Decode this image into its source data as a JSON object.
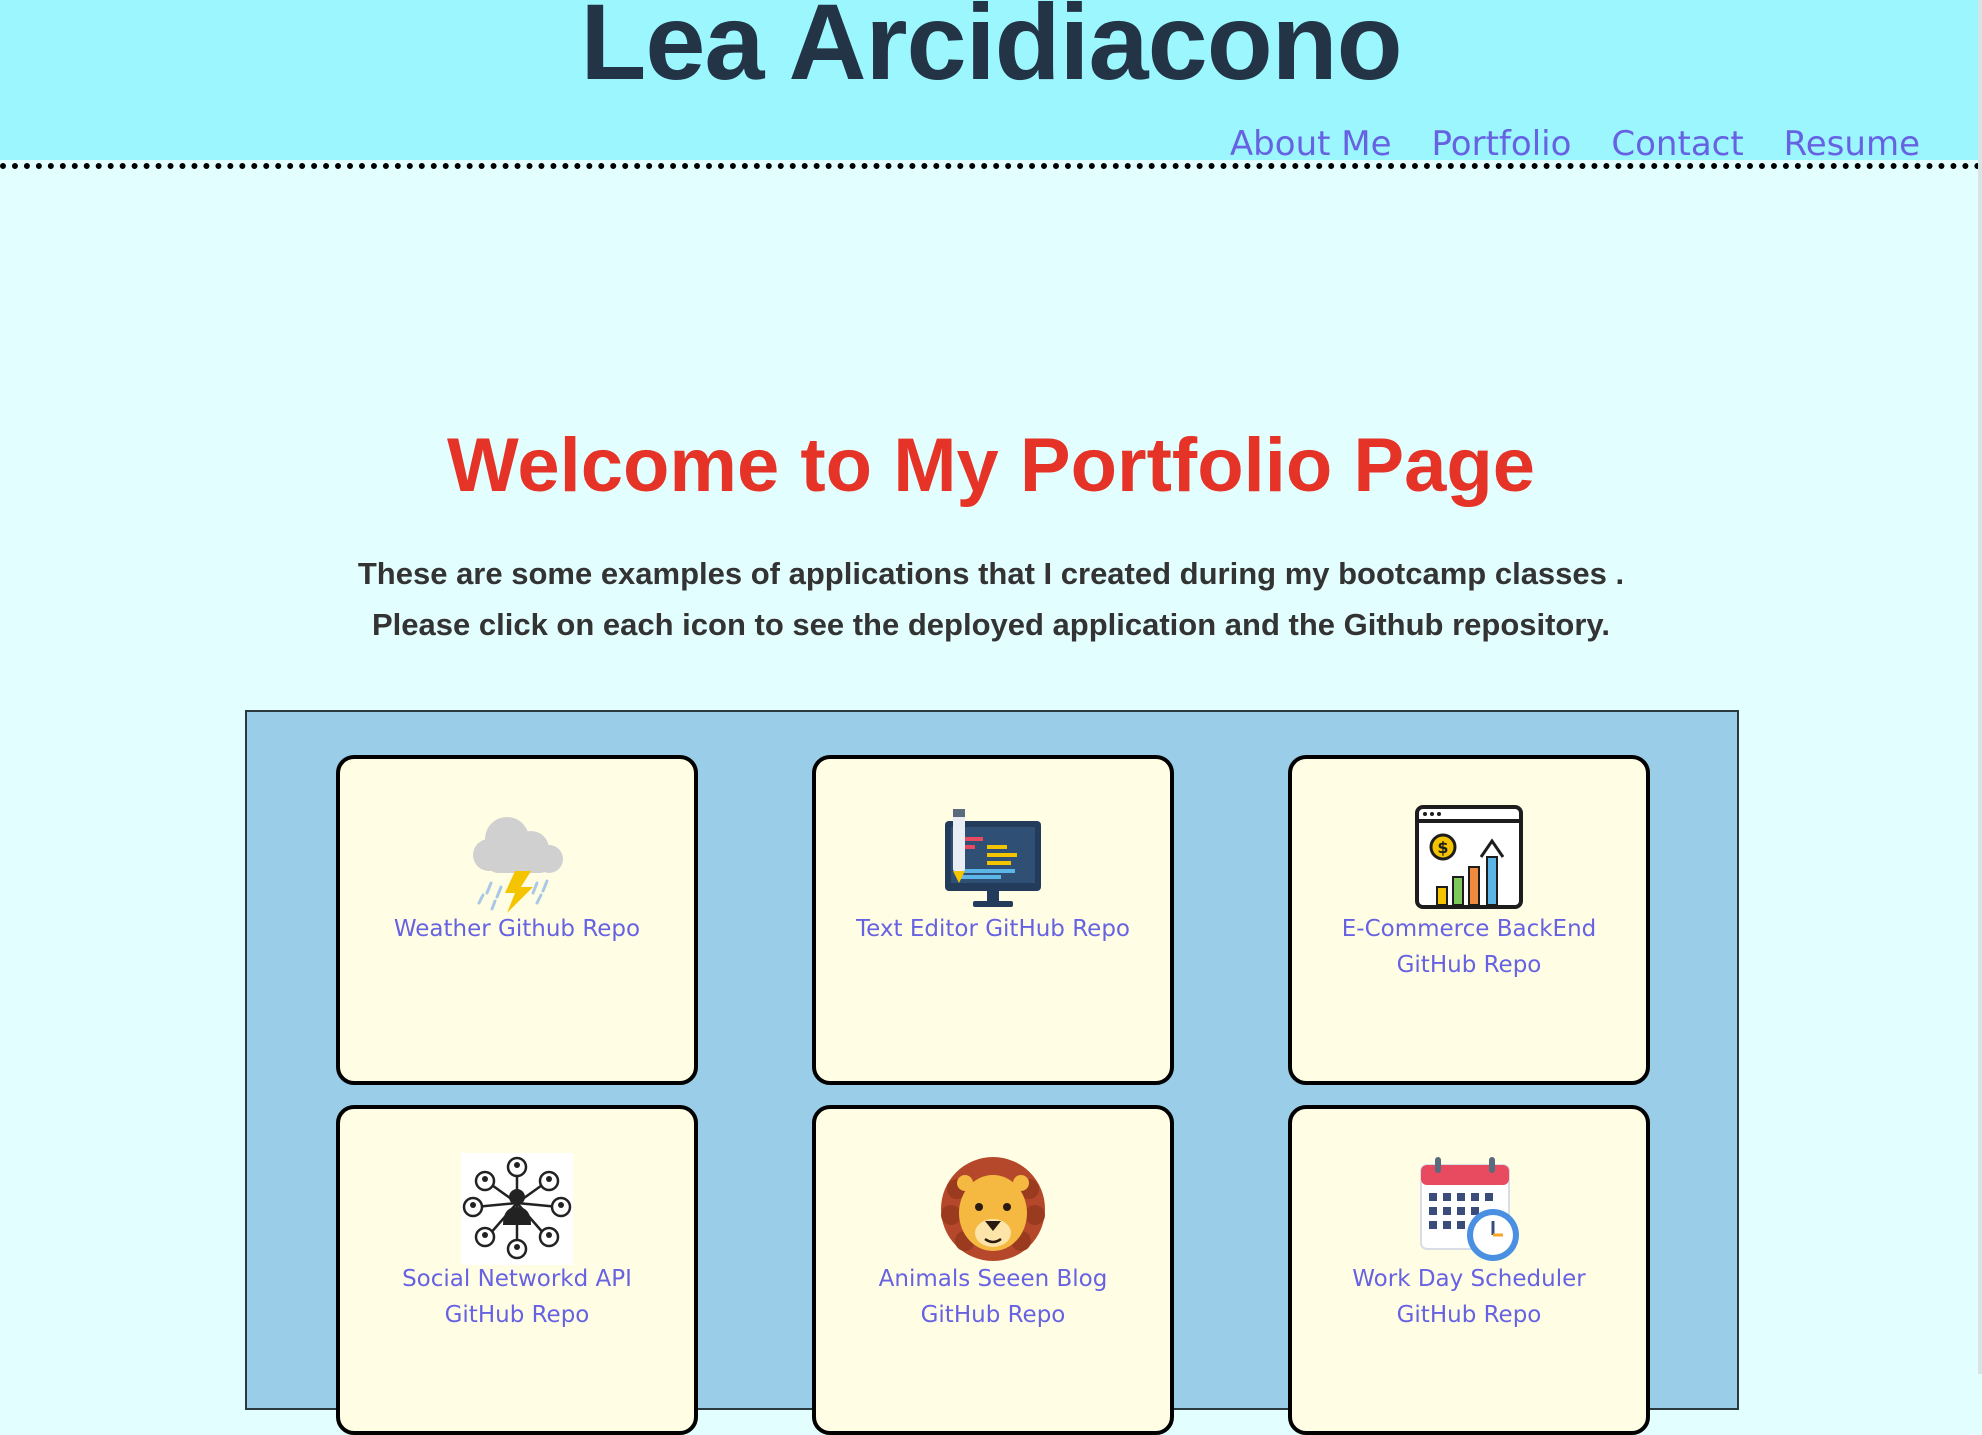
{
  "header": {
    "title": "Lea Arcidiacono",
    "nav": [
      "About Me",
      "Portfolio",
      "Contact",
      "Resume"
    ]
  },
  "main": {
    "heading": "Welcome to My Portfolio Page",
    "intro_line1": "These are some examples of applications that I created during my bootcamp classes .",
    "intro_line2": "Please click on each icon to see the deployed application and the Github repository."
  },
  "projects": [
    {
      "label": "Weather Github Repo",
      "icon": "weather-storm-icon"
    },
    {
      "label": "Text Editor GitHub Repo",
      "icon": "code-editor-monitor-icon"
    },
    {
      "label": "E-Commerce BackEnd GitHub Repo",
      "icon": "ecommerce-growth-chart-icon"
    },
    {
      "label": "Social Networkd API GitHub Repo",
      "icon": "social-network-icon"
    },
    {
      "label": "Animals Seeen Blog GitHub Repo",
      "icon": "lion-icon"
    },
    {
      "label": "Work Day Scheduler GitHub Repo",
      "icon": "calendar-clock-icon"
    }
  ],
  "colors": {
    "header_bg": "#9bf7fd",
    "page_bg": "#e3fefe",
    "title": "#233447",
    "link": "#6762e2",
    "heading": "#e53328",
    "gallery_bg": "#9acde8",
    "card_bg": "#fffee4"
  }
}
